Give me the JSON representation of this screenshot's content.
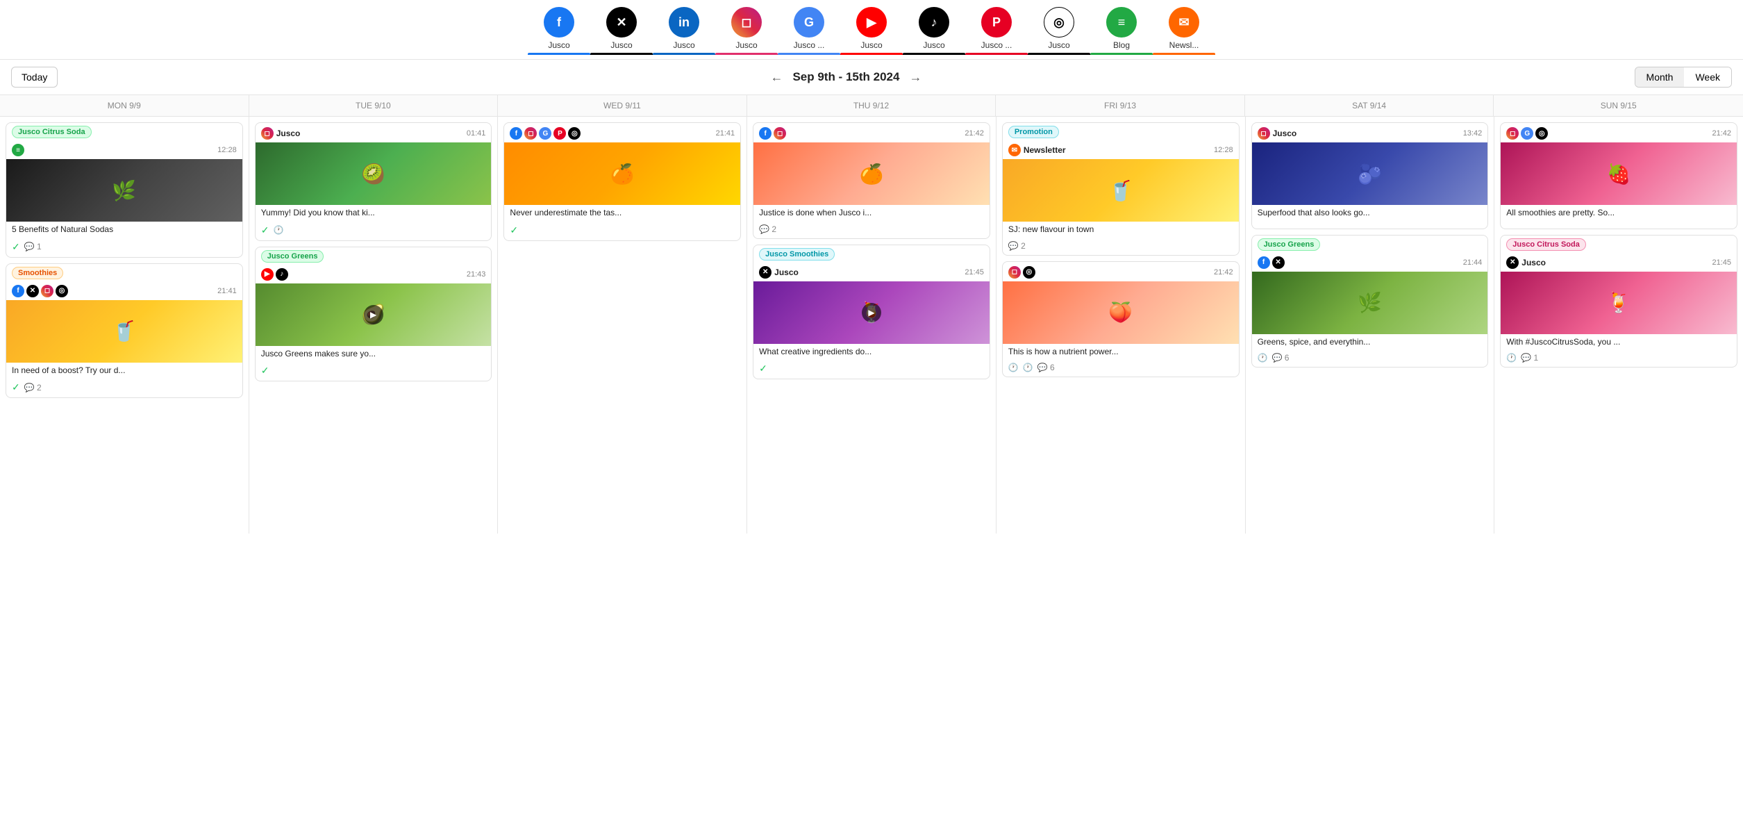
{
  "channels": [
    {
      "id": "fb",
      "name": "Jusco",
      "icon": "f",
      "iconClass": "si-fb",
      "color": "#1877f2"
    },
    {
      "id": "x",
      "name": "Jusco",
      "icon": "✕",
      "iconClass": "si-x",
      "color": "#000"
    },
    {
      "id": "li",
      "name": "Jusco",
      "icon": "in",
      "iconClass": "si-li",
      "color": "#0a66c2"
    },
    {
      "id": "ig",
      "name": "Jusco",
      "icon": "◻",
      "iconClass": "si-ig",
      "color": "#e1306c"
    },
    {
      "id": "go",
      "name": "Jusco ...",
      "icon": "G",
      "iconClass": "si-go",
      "color": "#4285f4"
    },
    {
      "id": "yt",
      "name": "Jusco",
      "icon": "▶",
      "iconClass": "si-yt",
      "color": "#ff0000"
    },
    {
      "id": "tk",
      "name": "Jusco",
      "icon": "♪",
      "iconClass": "si-tk",
      "color": "#000"
    },
    {
      "id": "pt",
      "name": "Jusco ...",
      "icon": "P",
      "iconClass": "si-pt",
      "color": "#e60023"
    },
    {
      "id": "th",
      "name": "Jusco",
      "icon": "◎",
      "iconClass": "si-th",
      "color": "#000"
    },
    {
      "id": "bl",
      "name": "Blog",
      "icon": "≡",
      "iconClass": "si-bl",
      "color": "#22a944"
    },
    {
      "id": "nl",
      "name": "Newsl...",
      "icon": "✉",
      "iconClass": "si-nl",
      "color": "#ff6600"
    }
  ],
  "header": {
    "today_label": "Today",
    "date_range": "Sep 9th - 15th 2024",
    "month_label": "Month",
    "week_label": "Week"
  },
  "days": [
    {
      "label": "MON 9/9"
    },
    {
      "label": "TUE 9/10"
    },
    {
      "label": "WED 9/11"
    },
    {
      "label": "THU 9/12"
    },
    {
      "label": "FRI 9/13"
    },
    {
      "label": "SAT 9/14"
    },
    {
      "label": "SUN 9/15"
    }
  ],
  "posts": {
    "mon": [
      {
        "tag": "Jusco Citrus Soda",
        "tagClass": "tag-green",
        "icons": [
          {
            "cls": "si-bl",
            "t": "≡"
          }
        ],
        "time": "12:28",
        "imgClass": "img-dark",
        "imgText": "🌿",
        "title": "5 Benefits of Natural Sodas",
        "hasCheck": true,
        "commentCount": "1",
        "hasClock": false
      },
      {
        "tag": "Smoothies",
        "tagClass": "tag-orange",
        "icons": [
          {
            "cls": "si-fb",
            "t": "f"
          },
          {
            "cls": "si-x",
            "t": "✕"
          },
          {
            "cls": "si-ig",
            "t": "◻"
          },
          {
            "cls": "si-th",
            "t": "◎"
          }
        ],
        "time": "21:41",
        "imgClass": "img-yellow",
        "imgText": "🥤",
        "title": "In need of a boost? Try our d...",
        "hasCheck": true,
        "commentCount": "2",
        "hasClock": false
      }
    ],
    "tue": [
      {
        "tag": null,
        "icons": [
          {
            "cls": "si-ig",
            "t": "◻"
          }
        ],
        "channelName": "Jusco",
        "time": "01:41",
        "imgClass": "img-green",
        "imgText": "🥝",
        "title": "Yummy! Did you know that ki...",
        "hasCheck": true,
        "hasClock": true,
        "commentCount": null
      },
      {
        "tag": "Jusco Greens",
        "tagClass": "tag-green",
        "icons": [
          {
            "cls": "si-yt",
            "t": "▶"
          },
          {
            "cls": "si-tk",
            "t": "♪"
          }
        ],
        "time": "21:43",
        "imgClass": "img-lime",
        "imgText": "🥑",
        "hasVideo": true,
        "title": "Jusco Greens makes sure yo...",
        "hasCheck": true,
        "commentCount": null
      }
    ],
    "wed": [
      {
        "tag": null,
        "icons": [
          {
            "cls": "si-fb",
            "t": "f"
          },
          {
            "cls": "si-ig",
            "t": "◻"
          },
          {
            "cls": "si-go",
            "t": "G"
          },
          {
            "cls": "si-pt",
            "t": "P"
          },
          {
            "cls": "si-th",
            "t": "◎"
          }
        ],
        "time": "21:41",
        "imgClass": "img-orange",
        "imgText": "🍊",
        "title": "Never underestimate the tas...",
        "hasCheck": true,
        "commentCount": null
      }
    ],
    "thu": [
      {
        "tag": null,
        "icons": [
          {
            "cls": "si-fb",
            "t": "f"
          },
          {
            "cls": "si-ig",
            "t": "◻"
          }
        ],
        "time": "21:42",
        "imgClass": "img-peach",
        "imgText": "🍊",
        "title": "Justice is done when Jusco i...",
        "hasCheck": false,
        "commentCount": "2"
      },
      {
        "tag": "Jusco Smoothies",
        "tagClass": "tag-cyan",
        "icons": [
          {
            "cls": "si-x",
            "t": "✕"
          }
        ],
        "channelName": "Jusco",
        "time": "21:45",
        "imgClass": "img-purple",
        "imgText": "🍹",
        "hasVideo": true,
        "title": "What creative ingredients do...",
        "hasCheck": true,
        "commentCount": null
      }
    ],
    "fri": [
      {
        "tag": "Promotion",
        "tagClass": "tag-cyan",
        "icons": [
          {
            "cls": "si-nl",
            "t": "✉"
          }
        ],
        "channelName": "Newsletter",
        "time": "12:28",
        "imgClass": "img-yellow",
        "imgText": "🥤",
        "title": "SJ: new flavour in town",
        "hasCheck": false,
        "commentCount": "2"
      },
      {
        "tag": null,
        "icons": [
          {
            "cls": "si-ig",
            "t": "◻"
          },
          {
            "cls": "si-th",
            "t": "◎"
          }
        ],
        "time": "21:42",
        "imgClass": "img-peach",
        "imgText": "🍑",
        "title": "This is how a nutrient power...",
        "hasCheck": false,
        "commentCount": null,
        "hasClock": true,
        "clockComment": "6"
      }
    ],
    "sat": [
      {
        "tag": null,
        "icons": [
          {
            "cls": "si-ig",
            "t": "◻"
          }
        ],
        "channelName": "Jusco",
        "time": "13:42",
        "imgClass": "img-berry",
        "imgText": "🫐",
        "title": "Superfood that also looks go...",
        "hasCheck": false,
        "commentCount": null
      },
      {
        "tag": "Jusco Greens",
        "tagClass": "tag-green",
        "icons": [
          {
            "cls": "si-fb",
            "t": "f"
          },
          {
            "cls": "si-x",
            "t": "✕"
          }
        ],
        "time": "21:44",
        "imgClass": "img-light-green",
        "imgText": "🌿",
        "title": "Greens, spice, and everythin...",
        "hasCheck": false,
        "hasClock": true,
        "commentCount": "6"
      }
    ],
    "sun": [
      {
        "tag": null,
        "icons": [
          {
            "cls": "si-ig",
            "t": "◻"
          },
          {
            "cls": "si-go",
            "t": "G"
          },
          {
            "cls": "si-th",
            "t": "◎"
          }
        ],
        "time": "21:42",
        "imgClass": "img-pink",
        "imgText": "🍓",
        "title": "All smoothies are pretty. So...",
        "hasCheck": false,
        "commentCount": null
      },
      {
        "tag": "Jusco Citrus Soda",
        "tagClass": "tag-pink",
        "icons": [
          {
            "cls": "si-x",
            "t": "✕"
          }
        ],
        "channelName": "Jusco",
        "time": "21:45",
        "imgClass": "img-pink",
        "imgText": "🍹",
        "title": "With #JuscoCitrusSoda, you ...",
        "hasCheck": false,
        "hasClock": true,
        "commentCount": "1"
      }
    ]
  }
}
